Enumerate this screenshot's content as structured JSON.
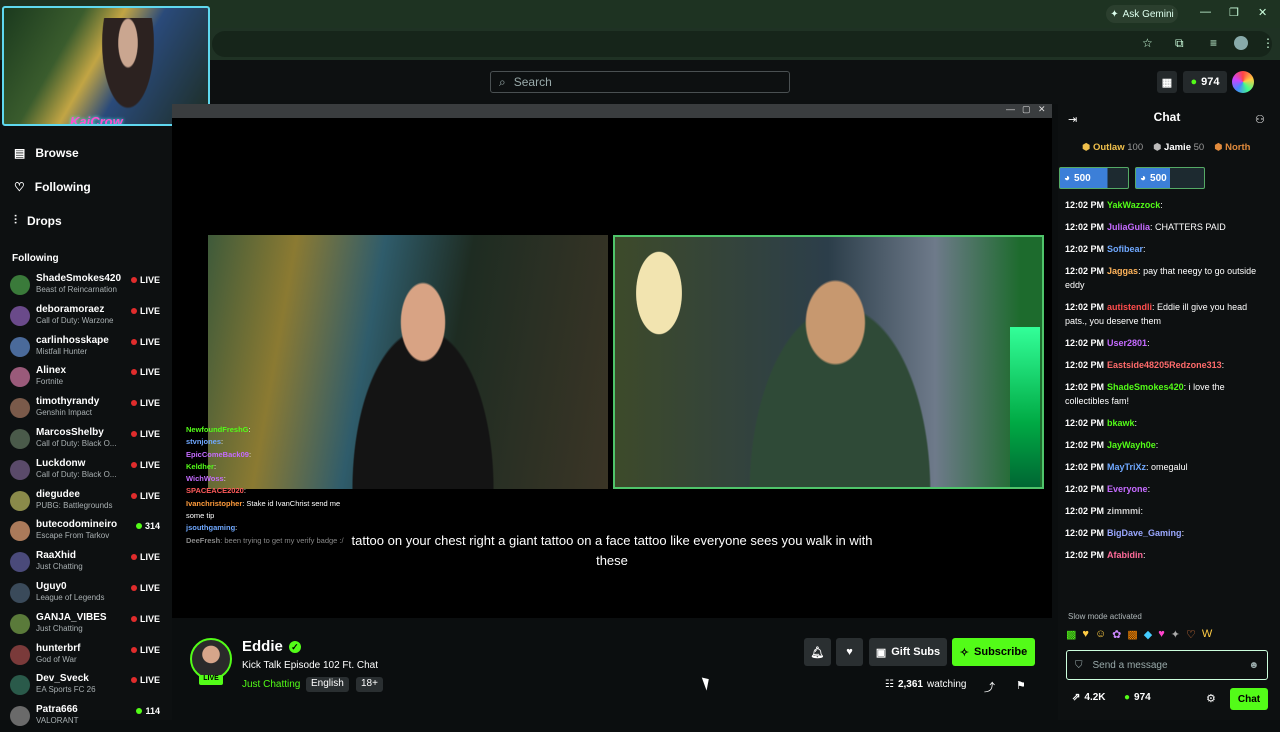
{
  "browser": {
    "ask_label": "Ask Gemini"
  },
  "header": {
    "search_placeholder": "Search",
    "points": "974"
  },
  "webcam": {
    "logo_text": "KaiCrow"
  },
  "sidebar": {
    "nav": [
      {
        "label": "Browse",
        "icon": "browse-icon"
      },
      {
        "label": "Following",
        "icon": "heart-icon"
      },
      {
        "label": "Drops",
        "icon": "drops-icon"
      }
    ],
    "following_heading": "Following",
    "channels": [
      {
        "name": "ShadeSmokes420",
        "game": "Beast of Reincarnation",
        "status": "LIVE",
        "color": "#3a7a3a"
      },
      {
        "name": "deboramoraez",
        "game": "Call of Duty: Warzone",
        "status": "LIVE",
        "color": "#6a4a8a"
      },
      {
        "name": "carlinhosskape",
        "game": "Mistfall Hunter",
        "status": "LIVE",
        "color": "#4a6a9a"
      },
      {
        "name": "Alinex",
        "game": "Fortnite",
        "status": "LIVE",
        "color": "#9a5a7a"
      },
      {
        "name": "timothyrandy",
        "game": "Genshin Impact",
        "status": "LIVE",
        "color": "#7a5a4a"
      },
      {
        "name": "MarcosShelby",
        "game": "Call of Duty: Black O...",
        "status": "LIVE",
        "color": "#4a5a4a"
      },
      {
        "name": "Luckdonw",
        "game": "Call of Duty: Black O...",
        "status": "LIVE",
        "color": "#5a4a6a"
      },
      {
        "name": "diegudee",
        "game": "PUBG: Battlegrounds",
        "status": "LIVE",
        "color": "#8a8a4a"
      },
      {
        "name": "butecodomineiro",
        "game": "Escape From Tarkov",
        "status": "314",
        "color": "#aa7a5a"
      },
      {
        "name": "RaaXhid",
        "game": "Just Chatting",
        "status": "LIVE",
        "color": "#4a4a7a"
      },
      {
        "name": "Uguy0",
        "game": "League of Legends",
        "status": "LIVE",
        "color": "#3a4a5a"
      },
      {
        "name": "GANJA_VIBES",
        "game": "Just Chatting",
        "status": "LIVE",
        "color": "#5a7a3a"
      },
      {
        "name": "hunterbrf",
        "game": "God of War",
        "status": "LIVE",
        "color": "#7a3a3a"
      },
      {
        "name": "Dev_Sveck",
        "game": "EA Sports FC 26",
        "status": "LIVE",
        "color": "#2a5a4a"
      },
      {
        "name": "Patra666",
        "game": "VALORANT",
        "status": "114",
        "color": "#6a6a6a"
      }
    ]
  },
  "overlay_chat": [
    {
      "user": "NewfoundFreshG",
      "text": ":",
      "color": "#53fc18"
    },
    {
      "user": "stvnjones",
      "text": ":",
      "color": "#6fa8ff"
    },
    {
      "user": "EpicComeBack09",
      "text": ":",
      "color": "#c56bff"
    },
    {
      "user": "Keldher",
      "text": ":",
      "color": "#53fc18"
    },
    {
      "user": "WichWoss",
      "text": ":",
      "color": "#c56bff"
    },
    {
      "user": "SPACEACE2020",
      "text": ":",
      "color": "#ff5b5b"
    },
    {
      "user": "Ivanchristopher",
      "text": ": Stake id IvanChrist send me some tip",
      "color": "#ff9b3b"
    },
    {
      "user": "jsouthgaming",
      "text": ":",
      "color": "#6fa8ff"
    },
    {
      "user": "DeeFresh",
      "text": ": been trying to get my verify badge :/",
      "color": "#888888"
    }
  ],
  "caption": "tattoo on your chest right a giant tattoo on a face tattoo like everyone sees you walk in with these",
  "stream": {
    "streamer": "Eddie",
    "title": "Kick Talk Episode 102 Ft. Chat",
    "category": "Just Chatting",
    "tags": [
      "English",
      "18+"
    ],
    "live_label": "LIVE",
    "gift_label": "Gift Subs",
    "subscribe_label": "Subscribe",
    "viewers": "2,361",
    "viewers_suffix": "watching"
  },
  "chat": {
    "title": "Chat",
    "kings": [
      {
        "name": "Outlaw",
        "count": "100"
      },
      {
        "name": "Jamie",
        "count": "50"
      },
      {
        "name": "North",
        "count": ""
      }
    ],
    "goals": [
      "500",
      "500"
    ],
    "messages": [
      {
        "time": "12:02 PM",
        "user": "YakWazzock",
        "text": ":",
        "color": "#53fc18"
      },
      {
        "time": "12:02 PM",
        "user": "JuliaGulia",
        "text": ": CHATTERS PAID",
        "color": "#c56bff"
      },
      {
        "time": "12:02 PM",
        "user": "Sofibear",
        "text": ":",
        "color": "#6fa8ff"
      },
      {
        "time": "12:02 PM",
        "user": "Jaggas",
        "text": ": pay that neegy to go outside eddy",
        "color": "#ffb45b"
      },
      {
        "time": "12:02 PM",
        "user": "autistendli",
        "text": ": Eddie ill give you head pats., you deserve them",
        "color": "#ff4d4d"
      },
      {
        "time": "12:02 PM",
        "user": "User2801",
        "text": ":",
        "color": "#c56bff"
      },
      {
        "time": "12:02 PM",
        "user": "Eastside48205Redzone313",
        "text": ":",
        "color": "#ff6b6b"
      },
      {
        "time": "12:02 PM",
        "user": "ShadeSmokes420",
        "text": ": i love the collectibles fam!",
        "color": "#53fc18"
      },
      {
        "time": "12:02 PM",
        "user": "bkawk",
        "text": ":",
        "color": "#53fc18"
      },
      {
        "time": "12:02 PM",
        "user": "JayWayh0e",
        "text": ":",
        "color": "#53fc18"
      },
      {
        "time": "12:02 PM",
        "user": "MayTriXz",
        "text": ": omegalul",
        "color": "#6fa8ff"
      },
      {
        "time": "12:02 PM",
        "user": "Everyone",
        "text": ":",
        "color": "#c56bff"
      },
      {
        "time": "12:02 PM",
        "user": "zimmmi",
        "text": ":",
        "color": "#c9c9c9"
      },
      {
        "time": "12:02 PM",
        "user": "BigDave_Gaming",
        "text": ":",
        "color": "#9aa8ff"
      },
      {
        "time": "12:02 PM",
        "user": "Afabidin",
        "text": ":",
        "color": "#ff6b9a"
      }
    ],
    "slow_mode": "Slow mode activated",
    "input_placeholder": "Send a message",
    "followers": "4.2K",
    "points": "974",
    "send_label": "Chat"
  },
  "colors": {
    "accent": "#53fc18"
  }
}
